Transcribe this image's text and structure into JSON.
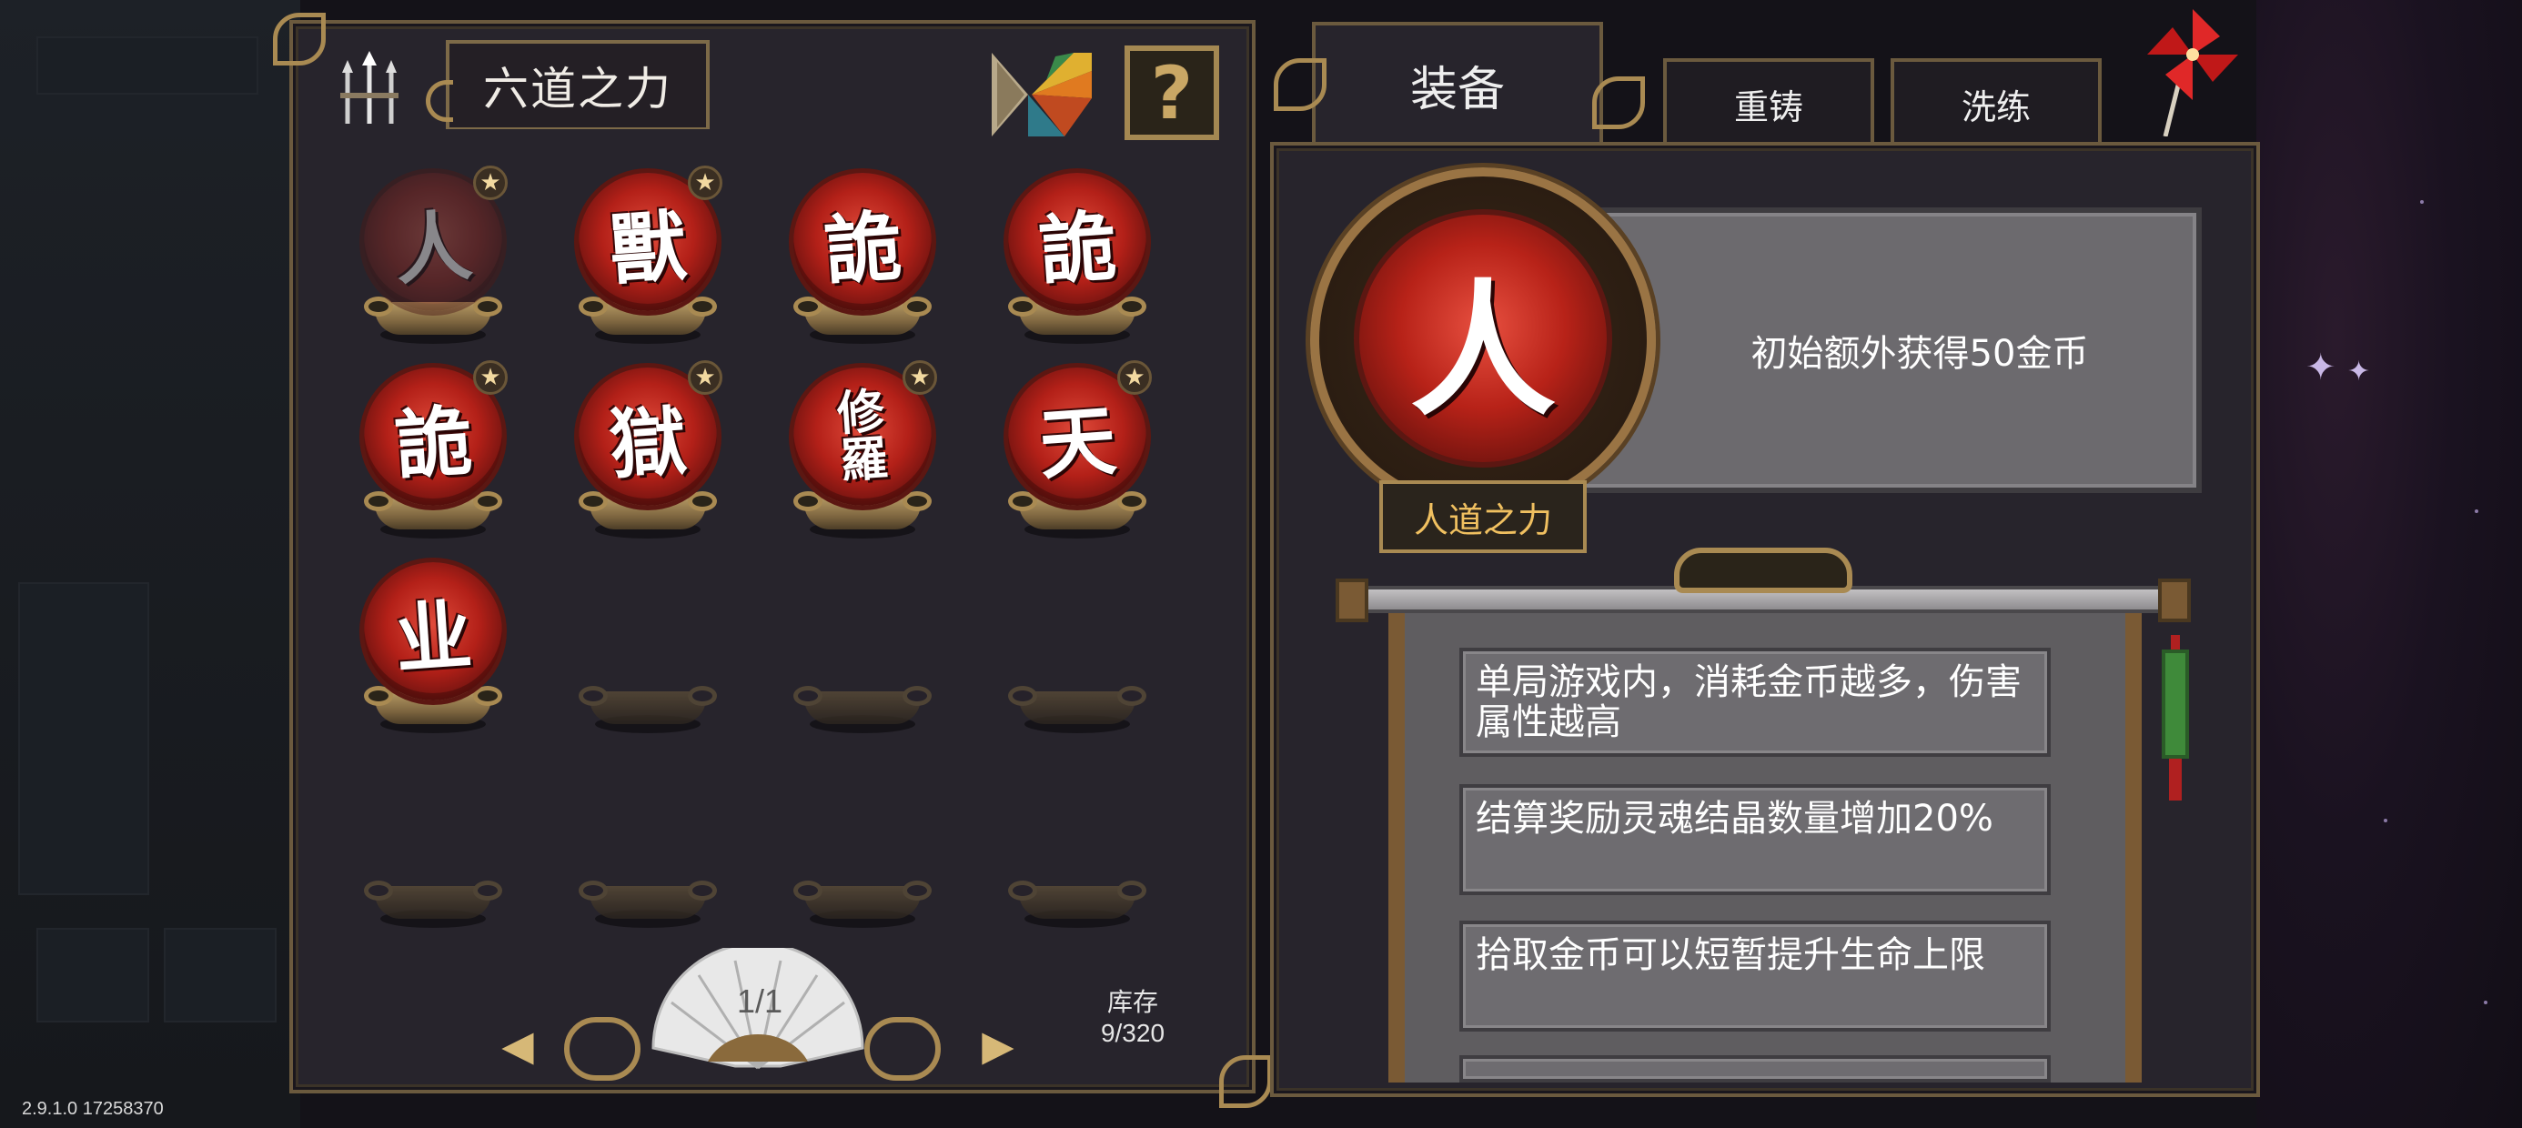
{
  "version": "2.9.1.0 17258370",
  "left_panel": {
    "title": "六道之力",
    "help_label": "?",
    "items": [
      {
        "glyph": "人",
        "starred": true,
        "dim": true
      },
      {
        "glyph": "獸",
        "starred": true,
        "dim": false
      },
      {
        "glyph": "詭",
        "starred": false,
        "dim": false
      },
      {
        "glyph": "詭",
        "starred": false,
        "dim": false
      },
      {
        "glyph": "詭",
        "starred": true,
        "dim": false
      },
      {
        "glyph": "獄",
        "starred": true,
        "dim": false
      },
      {
        "glyph": "修羅",
        "starred": true,
        "dim": false
      },
      {
        "glyph": "天",
        "starred": true,
        "dim": false
      },
      {
        "glyph": "业",
        "starred": false,
        "dim": false
      }
    ],
    "empty_slots": 7,
    "page": "1/1",
    "prev_icon": "◀",
    "next_icon": "▶",
    "stock_label": "库存",
    "stock_value": "9/320"
  },
  "tabs": {
    "equip": "装备",
    "recast": "重铸",
    "refine": "洗练"
  },
  "detail": {
    "glyph": "人",
    "name": "人道之力",
    "description": "初始额外获得50金币",
    "effects": [
      "单局游戏内，消耗金币越多，伤害属性越高",
      "结算奖励灵魂结晶数量增加20%",
      "拾取金币可以短暂提升生命上限"
    ]
  },
  "colors": {
    "panel": "#27242c",
    "gold_trim": "#a98a52",
    "orb_red": "#b32018",
    "name_gold": "#f0c060"
  },
  "icons": {
    "weapon": "trident-weapons-icon",
    "tangram": "tangram-icon",
    "star": "star-badge-icon",
    "pinwheel": "pinwheel-icon",
    "fan": "folding-fan-icon"
  }
}
